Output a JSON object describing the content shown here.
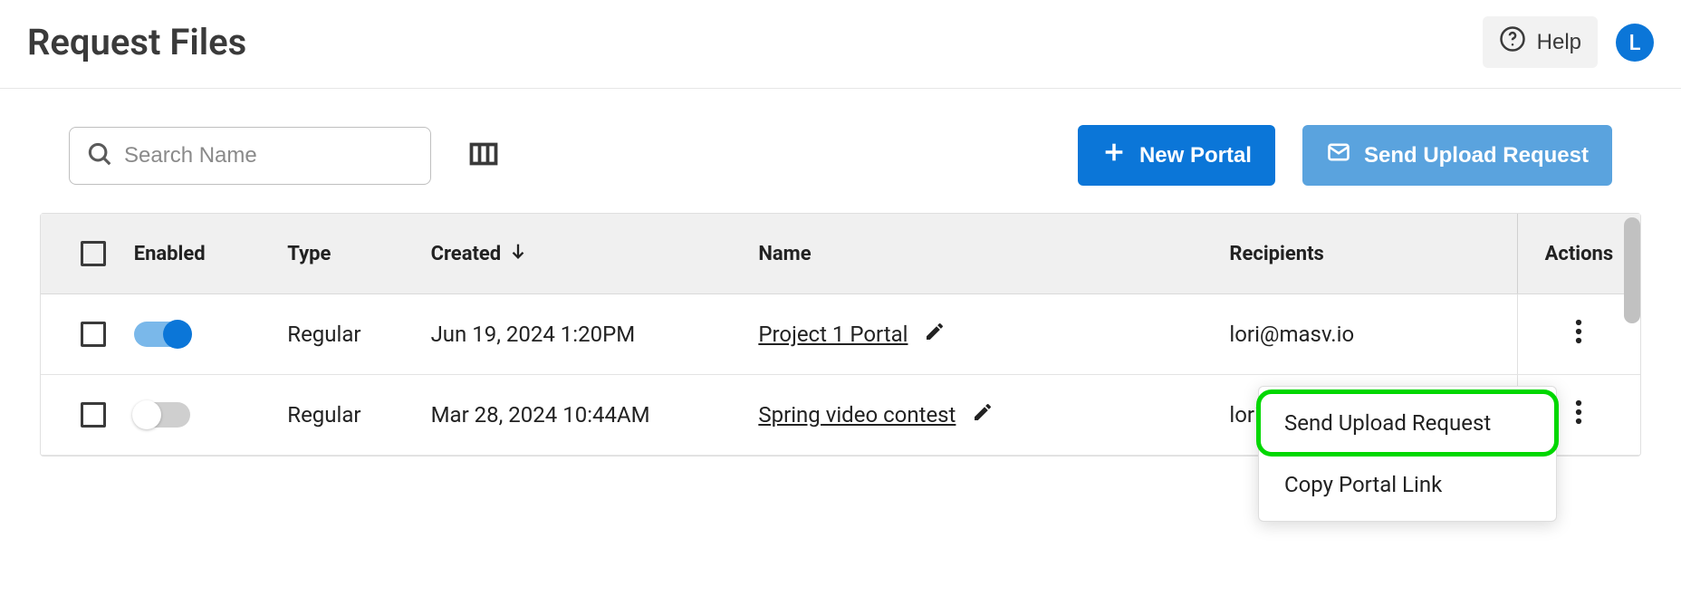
{
  "header": {
    "title": "Request Files",
    "help_label": "Help",
    "avatar_initial": "L"
  },
  "toolbar": {
    "search_placeholder": "Search Name",
    "new_portal_label": "New Portal",
    "send_upload_request_label": "Send Upload Request"
  },
  "table": {
    "columns": {
      "enabled": "Enabled",
      "type": "Type",
      "created": "Created",
      "name": "Name",
      "recipients": "Recipients",
      "actions": "Actions"
    },
    "sort_column": "created",
    "sort_direction": "desc",
    "rows": [
      {
        "enabled": true,
        "type": "Regular",
        "created": "Jun 19, 2024 1:20PM",
        "name": "Project 1 Portal",
        "recipients": "lori@masv.io"
      },
      {
        "enabled": false,
        "type": "Regular",
        "created": "Mar 28, 2024 10:44AM",
        "name": "Spring video contest",
        "recipients": "lori+"
      }
    ]
  },
  "actions_menu": {
    "items": [
      "Send Upload Request",
      "Copy Portal Link"
    ],
    "highlighted_index": 0
  }
}
